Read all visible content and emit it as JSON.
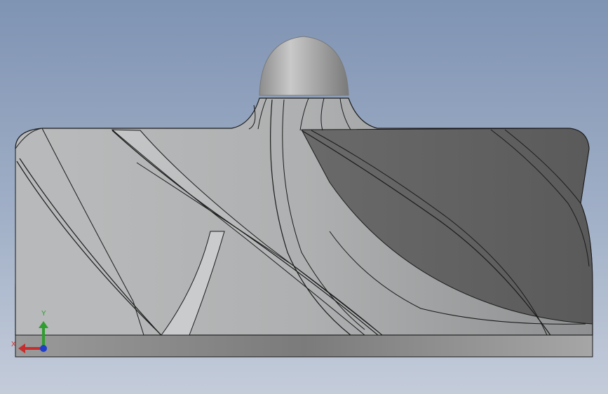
{
  "viewport": {
    "background_top": "#7f93b3",
    "background_bottom": "#c4ccda",
    "model": {
      "type": "impeller",
      "view": "front",
      "blade_count_visible": 5
    },
    "triad": {
      "x_label": "X",
      "y_label": "Y",
      "x_color": "#c62d2d",
      "y_color": "#2f9d2f",
      "z_color": "#1f3ec9"
    }
  }
}
